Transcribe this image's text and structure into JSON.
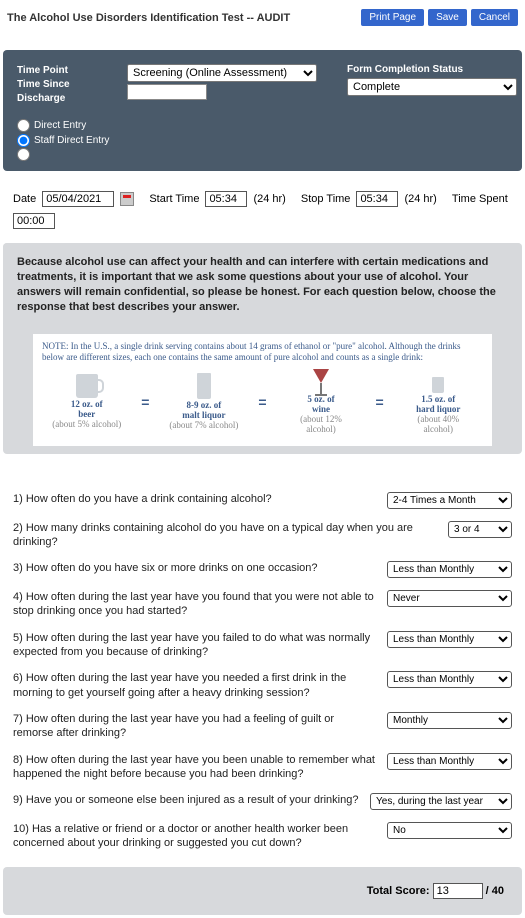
{
  "header": {
    "title": "The Alcohol Use Disorders Identification Test -- AUDIT",
    "print": "Print Page",
    "save": "Save",
    "cancel": "Cancel"
  },
  "block": {
    "time_point_label1": "Time Point",
    "time_point_label2": "Time Since",
    "time_point_label3": "Discharge",
    "time_point_value": "Screening (Online Assessment)",
    "fc_label": "Form Completion Status",
    "fc_value": "Complete",
    "radio_direct": "Direct Entry",
    "radio_staff": "Staff Direct Entry"
  },
  "time": {
    "date_label": "Date",
    "date_value": "05/04/2021",
    "start_label": "Start Time",
    "start_value": "05:34",
    "start_hint": "(24 hr)",
    "stop_label": "Stop Time",
    "stop_value": "05:34",
    "stop_hint": "(24 hr)",
    "spent_label": "Time Spent",
    "spent_value": "00:00"
  },
  "instruction": "Because alcohol use can affect your health and can interfere with certain medications and treatments, it is important that we ask some questions about your use of alcohol. Your answers will remain confidential, so please be honest. For each question below, choose the response that best describes your answer.",
  "drink_note": "NOTE: In the U.S., a single drink serving contains about 14 grams of ethanol or \"pure\" alcohol. Although the drinks below are different sizes, each one contains the same amount of pure alcohol and counts as a single drink:",
  "drinks": {
    "beer_t": "12 oz. of",
    "beer_b": "beer",
    "beer_s": "(about 5% alcohol)",
    "malt_t": "8-9 oz. of",
    "malt_b": "malt liquor",
    "malt_s": "(about 7% alcohol)",
    "wine_t": "5 oz. of",
    "wine_b": "wine",
    "wine_s": "(about 12% alcohol)",
    "liq_t": "1.5 oz. of",
    "liq_b": "hard liquor",
    "liq_s": "(about 40% alcohol)"
  },
  "q": {
    "q1": "1) How often do you have a drink containing alcohol?",
    "q2": "2) How many drinks containing alcohol do you have on a typical day when you are drinking?",
    "q3": "3) How often do you have six or more drinks on one occasion?",
    "q4": "4) How often during the last year have you found that you were not able to stop drinking once you had started?",
    "q5": "5) How often during the last year have you failed to do what was normally expected from you because of drinking?",
    "q6": "6) How often during the last year have you needed a first drink in the morning to get yourself going after a heavy drinking session?",
    "q7": "7) How often during the last year have you had a feeling of guilt or remorse after drinking?",
    "q8": "8) How often during the last year have you been unable to remember what happened the night before because you had been drinking?",
    "q9": "9) Have you or someone else been injured as a result of your drinking?",
    "q10": "10) Has a relative or friend or a doctor or another health worker been concerned about your drinking or suggested you cut down?"
  },
  "a": {
    "a1": "2-4 Times a Month",
    "a2": "3 or 4",
    "a3": "Less than Monthly",
    "a4": "Never",
    "a5": "Less than Monthly",
    "a6": "Less than Monthly",
    "a7": "Monthly",
    "a8": "Less than Monthly",
    "a9": "Yes, during the last year",
    "a10": "No"
  },
  "score": {
    "label": "Total Score:",
    "value": "13",
    "of": "/ 40"
  }
}
